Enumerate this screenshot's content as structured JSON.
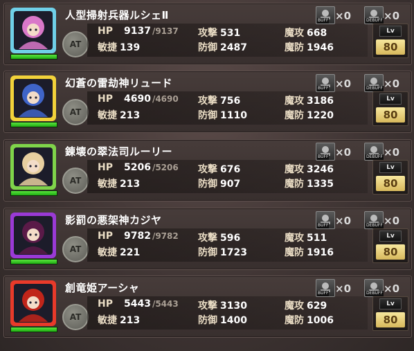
{
  "labels": {
    "hp": "HP",
    "agi": "敏捷",
    "atk": "攻撃",
    "def": "防御",
    "matk": "魔攻",
    "mdef": "魔防",
    "at": "AT",
    "lv": "Lv",
    "buff": "BUFF",
    "debuff": "DEBUFF"
  },
  "units": [
    {
      "name": "人型掃射兵器ルシェⅡ",
      "hp": "9137",
      "hp_max": "/9137",
      "agi": "139",
      "atk": "531",
      "def": "2487",
      "matk": "668",
      "mdef": "1946",
      "buff_count": "×0",
      "debuff_count": "×0",
      "level": "80",
      "hp_fraction": 1.0,
      "frame_color": "#6fd0e8",
      "portrait_color": "#d978c9"
    },
    {
      "name": "幻蒼の雷劫神リュード",
      "hp": "4690",
      "hp_max": "/4690",
      "agi": "213",
      "atk": "756",
      "def": "1110",
      "matk": "3186",
      "mdef": "1220",
      "buff_count": "×0",
      "debuff_count": "×0",
      "level": "80",
      "hp_fraction": 1.0,
      "frame_color": "#f2d23a",
      "portrait_color": "#3f64c8"
    },
    {
      "name": "錬壊の翠法司ルーリー",
      "hp": "5206",
      "hp_max": "/5206",
      "agi": "213",
      "atk": "676",
      "def": "907",
      "matk": "3246",
      "mdef": "1335",
      "buff_count": "×0",
      "debuff_count": "×0",
      "level": "80",
      "hp_fraction": 1.0,
      "frame_color": "#7fd44a",
      "portrait_color": "#e8cfa0"
    },
    {
      "name": "影罰の悪架神カジヤ",
      "hp": "9782",
      "hp_max": "/9782",
      "agi": "221",
      "atk": "596",
      "def": "1723",
      "matk": "511",
      "mdef": "1916",
      "buff_count": "×0",
      "debuff_count": "×0",
      "level": "80",
      "hp_fraction": 1.0,
      "frame_color": "#9a3ad6",
      "portrait_color": "#5a1a48"
    },
    {
      "name": "創竜姫アーシャ",
      "hp": "5443",
      "hp_max": "/5443",
      "agi": "213",
      "atk": "3130",
      "def": "1400",
      "matk": "629",
      "mdef": "1006",
      "buff_count": "×0",
      "debuff_count": "×0",
      "level": "80",
      "hp_fraction": 1.0,
      "frame_color": "#e83a2a",
      "portrait_color": "#c0251a"
    }
  ]
}
